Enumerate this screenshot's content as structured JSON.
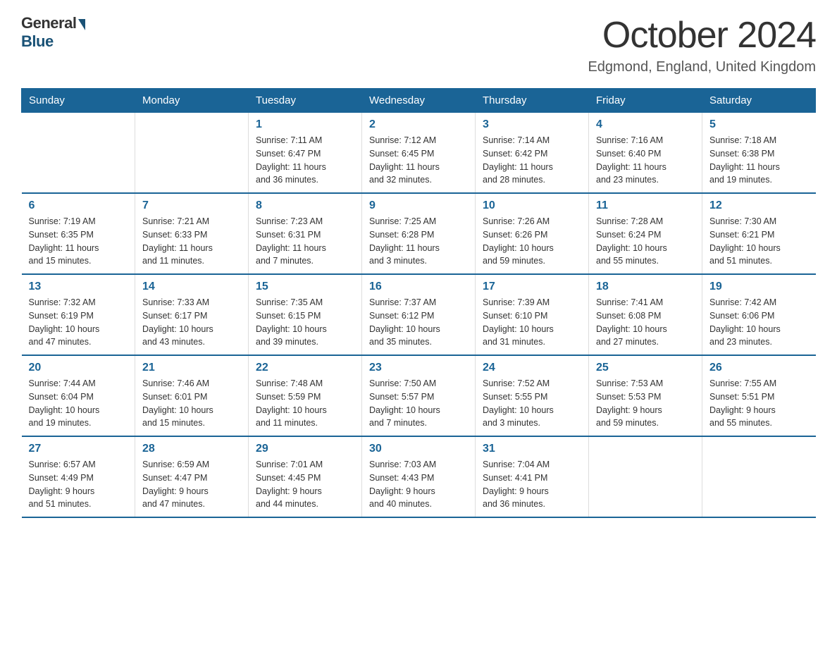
{
  "logo": {
    "general": "General",
    "blue": "Blue"
  },
  "header": {
    "month": "October 2024",
    "location": "Edgmond, England, United Kingdom"
  },
  "days_of_week": [
    "Sunday",
    "Monday",
    "Tuesday",
    "Wednesday",
    "Thursday",
    "Friday",
    "Saturday"
  ],
  "weeks": [
    [
      {
        "day": "",
        "info": ""
      },
      {
        "day": "",
        "info": ""
      },
      {
        "day": "1",
        "info": "Sunrise: 7:11 AM\nSunset: 6:47 PM\nDaylight: 11 hours\nand 36 minutes."
      },
      {
        "day": "2",
        "info": "Sunrise: 7:12 AM\nSunset: 6:45 PM\nDaylight: 11 hours\nand 32 minutes."
      },
      {
        "day": "3",
        "info": "Sunrise: 7:14 AM\nSunset: 6:42 PM\nDaylight: 11 hours\nand 28 minutes."
      },
      {
        "day": "4",
        "info": "Sunrise: 7:16 AM\nSunset: 6:40 PM\nDaylight: 11 hours\nand 23 minutes."
      },
      {
        "day": "5",
        "info": "Sunrise: 7:18 AM\nSunset: 6:38 PM\nDaylight: 11 hours\nand 19 minutes."
      }
    ],
    [
      {
        "day": "6",
        "info": "Sunrise: 7:19 AM\nSunset: 6:35 PM\nDaylight: 11 hours\nand 15 minutes."
      },
      {
        "day": "7",
        "info": "Sunrise: 7:21 AM\nSunset: 6:33 PM\nDaylight: 11 hours\nand 11 minutes."
      },
      {
        "day": "8",
        "info": "Sunrise: 7:23 AM\nSunset: 6:31 PM\nDaylight: 11 hours\nand 7 minutes."
      },
      {
        "day": "9",
        "info": "Sunrise: 7:25 AM\nSunset: 6:28 PM\nDaylight: 11 hours\nand 3 minutes."
      },
      {
        "day": "10",
        "info": "Sunrise: 7:26 AM\nSunset: 6:26 PM\nDaylight: 10 hours\nand 59 minutes."
      },
      {
        "day": "11",
        "info": "Sunrise: 7:28 AM\nSunset: 6:24 PM\nDaylight: 10 hours\nand 55 minutes."
      },
      {
        "day": "12",
        "info": "Sunrise: 7:30 AM\nSunset: 6:21 PM\nDaylight: 10 hours\nand 51 minutes."
      }
    ],
    [
      {
        "day": "13",
        "info": "Sunrise: 7:32 AM\nSunset: 6:19 PM\nDaylight: 10 hours\nand 47 minutes."
      },
      {
        "day": "14",
        "info": "Sunrise: 7:33 AM\nSunset: 6:17 PM\nDaylight: 10 hours\nand 43 minutes."
      },
      {
        "day": "15",
        "info": "Sunrise: 7:35 AM\nSunset: 6:15 PM\nDaylight: 10 hours\nand 39 minutes."
      },
      {
        "day": "16",
        "info": "Sunrise: 7:37 AM\nSunset: 6:12 PM\nDaylight: 10 hours\nand 35 minutes."
      },
      {
        "day": "17",
        "info": "Sunrise: 7:39 AM\nSunset: 6:10 PM\nDaylight: 10 hours\nand 31 minutes."
      },
      {
        "day": "18",
        "info": "Sunrise: 7:41 AM\nSunset: 6:08 PM\nDaylight: 10 hours\nand 27 minutes."
      },
      {
        "day": "19",
        "info": "Sunrise: 7:42 AM\nSunset: 6:06 PM\nDaylight: 10 hours\nand 23 minutes."
      }
    ],
    [
      {
        "day": "20",
        "info": "Sunrise: 7:44 AM\nSunset: 6:04 PM\nDaylight: 10 hours\nand 19 minutes."
      },
      {
        "day": "21",
        "info": "Sunrise: 7:46 AM\nSunset: 6:01 PM\nDaylight: 10 hours\nand 15 minutes."
      },
      {
        "day": "22",
        "info": "Sunrise: 7:48 AM\nSunset: 5:59 PM\nDaylight: 10 hours\nand 11 minutes."
      },
      {
        "day": "23",
        "info": "Sunrise: 7:50 AM\nSunset: 5:57 PM\nDaylight: 10 hours\nand 7 minutes."
      },
      {
        "day": "24",
        "info": "Sunrise: 7:52 AM\nSunset: 5:55 PM\nDaylight: 10 hours\nand 3 minutes."
      },
      {
        "day": "25",
        "info": "Sunrise: 7:53 AM\nSunset: 5:53 PM\nDaylight: 9 hours\nand 59 minutes."
      },
      {
        "day": "26",
        "info": "Sunrise: 7:55 AM\nSunset: 5:51 PM\nDaylight: 9 hours\nand 55 minutes."
      }
    ],
    [
      {
        "day": "27",
        "info": "Sunrise: 6:57 AM\nSunset: 4:49 PM\nDaylight: 9 hours\nand 51 minutes."
      },
      {
        "day": "28",
        "info": "Sunrise: 6:59 AM\nSunset: 4:47 PM\nDaylight: 9 hours\nand 47 minutes."
      },
      {
        "day": "29",
        "info": "Sunrise: 7:01 AM\nSunset: 4:45 PM\nDaylight: 9 hours\nand 44 minutes."
      },
      {
        "day": "30",
        "info": "Sunrise: 7:03 AM\nSunset: 4:43 PM\nDaylight: 9 hours\nand 40 minutes."
      },
      {
        "day": "31",
        "info": "Sunrise: 7:04 AM\nSunset: 4:41 PM\nDaylight: 9 hours\nand 36 minutes."
      },
      {
        "day": "",
        "info": ""
      },
      {
        "day": "",
        "info": ""
      }
    ]
  ]
}
